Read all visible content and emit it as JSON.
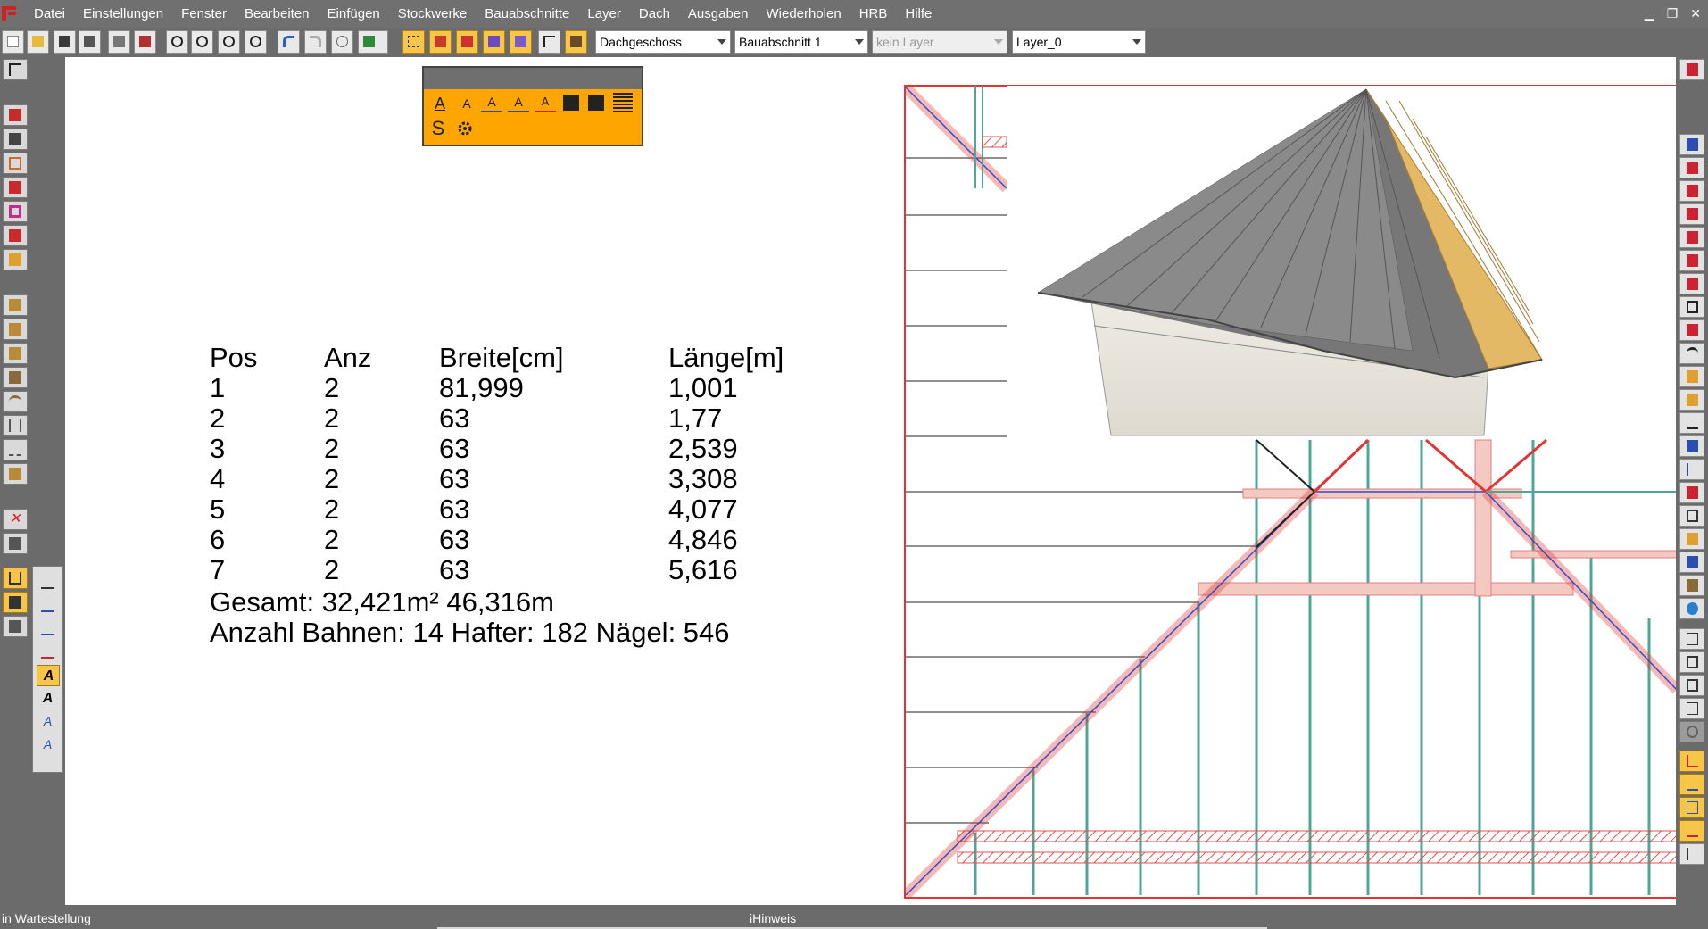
{
  "menubar": {
    "items": [
      "Datei",
      "Einstellungen",
      "Fenster",
      "Bearbeiten",
      "Einfügen",
      "Stockwerke",
      "Bauabschnitte",
      "Layer",
      "Dach",
      "Ausgaben",
      "Wiederholen",
      "HRB",
      "Hilfe"
    ],
    "window_controls": [
      "minimize-icon",
      "restore-icon",
      "close-icon"
    ]
  },
  "toolbar": {
    "floor_select": "Dachgeschoss",
    "section_select": "Bauabschnitt 1",
    "layer_filter_select": "kein Layer",
    "layer_select": "Layer_0"
  },
  "palette": {
    "title": "",
    "row2_label": "S"
  },
  "table": {
    "headers": [
      "Pos",
      "Anz",
      "Breite[cm]",
      "Länge[m]"
    ],
    "rows": [
      [
        "1",
        "2",
        "81,999",
        "1,001"
      ],
      [
        "2",
        "2",
        "63",
        "1,77"
      ],
      [
        "3",
        "2",
        "63",
        "2,539"
      ],
      [
        "4",
        "2",
        "63",
        "3,308"
      ],
      [
        "5",
        "2",
        "63",
        "4,077"
      ],
      [
        "6",
        "2",
        "63",
        "4,846"
      ],
      [
        "7",
        "2",
        "63",
        "5,616"
      ]
    ],
    "total": "Gesamt: 32,421m²  46,316m",
    "counts": "Anzahl Bahnen: 14  Hafter: 182  Nägel: 546"
  },
  "statusbar": {
    "left": "in Wartestellung",
    "center": "iHinweis"
  },
  "colors": {
    "accent": "#f7c548",
    "palette_bg": "#ffa500",
    "chrome": "#6b6b6b",
    "rafter_red": "#e04040",
    "stud_teal": "#4fa596"
  }
}
